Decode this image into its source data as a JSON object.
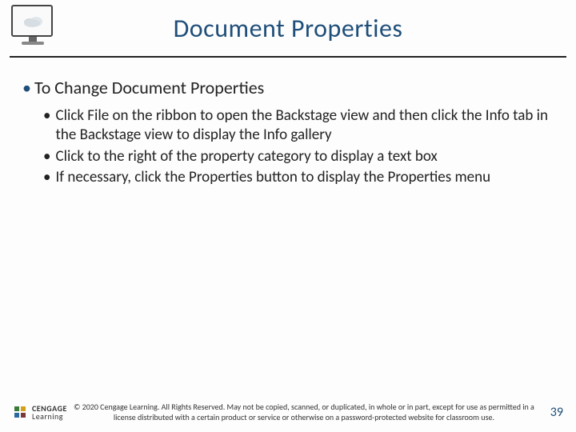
{
  "header": {
    "title": "Document Properties",
    "icon": "monitor-cloud-icon"
  },
  "content": {
    "main_bullet": "To Change Document Properties",
    "sub_bullets": [
      "Click File on the ribbon to open the Backstage view and then click the Info tab in the Backstage view to display the Info gallery",
      "Click to the right of the property category to display a text box",
      "If necessary, click the Properties button to display the Properties menu"
    ]
  },
  "footer": {
    "logo_top": "CENGAGE",
    "logo_bottom": "Learning",
    "copyright": "© 2020 Cengage Learning. All Rights Reserved. May not be copied, scanned, or duplicated, in whole or in part, except for use as permitted in a license distributed with a certain product or service or otherwise on a password-protected website for classroom use.",
    "page_number": "39"
  }
}
